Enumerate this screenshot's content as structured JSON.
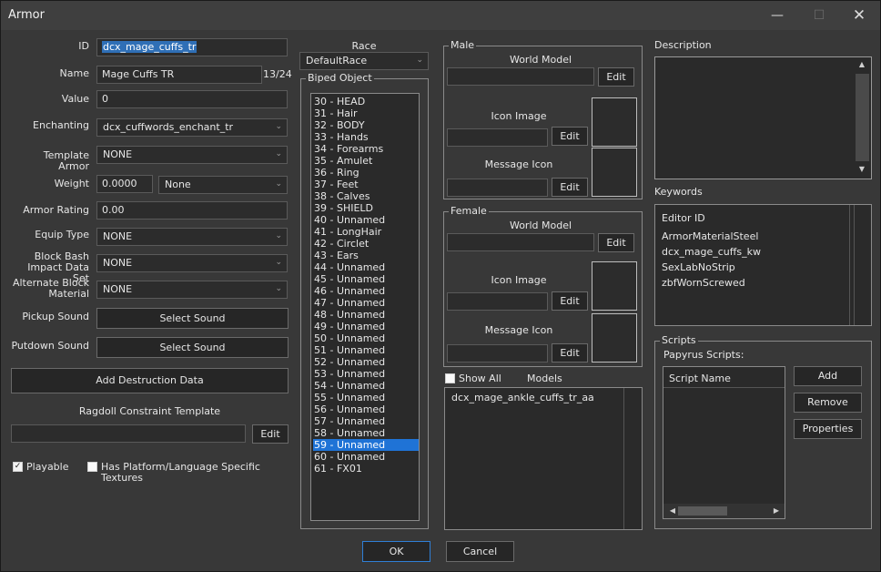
{
  "window": {
    "title": "Armor",
    "minimize_icon": "minimize-icon",
    "maximize_icon": "maximize-icon",
    "close_icon": "close-icon"
  },
  "form": {
    "id_label": "ID",
    "id_value": "dcx_mage_cuffs_tr",
    "name_label": "Name",
    "name_value": "Mage Cuffs TR",
    "name_count": "13/24",
    "value_label": "Value",
    "value_value": "0",
    "enchanting_label": "Enchanting",
    "enchanting_value": "dcx_cuffwords_enchant_tr",
    "template_label": "Template Armor",
    "template_value": "NONE",
    "weight_label": "Weight",
    "weight_value": "0.0000",
    "weight_type": "None",
    "rating_label": "Armor Rating",
    "rating_value": "0.00",
    "equip_label": "Equip Type",
    "equip_value": "NONE",
    "blockbash_label_1": "Block Bash",
    "blockbash_label_2": "Impact Data Set",
    "blockbash_value": "NONE",
    "altblock_label_1": "Alternate Block",
    "altblock_label_2": "Material",
    "altblock_value": "NONE",
    "pickup_label": "Pickup Sound",
    "pickup_button": "Select Sound",
    "putdown_label": "Putdown Sound",
    "putdown_button": "Select Sound",
    "destruction_button": "Add Destruction Data",
    "ragdoll_label": "Ragdoll Constraint Template",
    "ragdoll_value": "",
    "ragdoll_edit": "Edit",
    "playable_label": "Playable",
    "playable_checked": true,
    "platform_label": "Has Platform/Language Specific Textures",
    "platform_checked": false
  },
  "race": {
    "label": "Race",
    "value": "DefaultRace"
  },
  "biped": {
    "label": "Biped Object",
    "items": [
      "30 - HEAD",
      "31 - Hair",
      "32 - BODY",
      "33 - Hands",
      "34 - Forearms",
      "35 - Amulet",
      "36 - Ring",
      "37 - Feet",
      "38 - Calves",
      "39 - SHIELD",
      "40 - Unnamed",
      "41 - LongHair",
      "42 - Circlet",
      "43 - Ears",
      "44 - Unnamed",
      "45 - Unnamed",
      "46 - Unnamed",
      "47 - Unnamed",
      "48 - Unnamed",
      "49 - Unnamed",
      "50 - Unnamed",
      "51 - Unnamed",
      "52 - Unnamed",
      "53 - Unnamed",
      "54 - Unnamed",
      "55 - Unnamed",
      "56 - Unnamed",
      "57 - Unnamed",
      "58 - Unnamed",
      "59 - Unnamed",
      "60 - Unnamed",
      "61 - FX01"
    ],
    "selected": "59 - Unnamed"
  },
  "male": {
    "label": "Male",
    "world_model": "World Model",
    "icon_image": "Icon Image",
    "message_icon": "Message Icon",
    "edit": "Edit"
  },
  "female": {
    "label": "Female",
    "world_model": "World Model",
    "icon_image": "Icon Image",
    "message_icon": "Message Icon",
    "edit": "Edit"
  },
  "models": {
    "show_all": "Show All",
    "label": "Models",
    "items": [
      "dcx_mage_ankle_cuffs_tr_aa"
    ]
  },
  "description": {
    "label": "Description",
    "value": ""
  },
  "keywords": {
    "label": "Keywords",
    "header": "Editor ID",
    "items": [
      "ArmorMaterialSteel",
      "dcx_mage_cuffs_kw",
      "SexLabNoStrip",
      "zbfWornScrewed"
    ]
  },
  "scripts": {
    "label": "Scripts",
    "sublabel": "Papyrus Scripts:",
    "header": "Script Name",
    "add": "Add",
    "remove": "Remove",
    "properties": "Properties"
  },
  "footer": {
    "ok": "OK",
    "cancel": "Cancel"
  }
}
